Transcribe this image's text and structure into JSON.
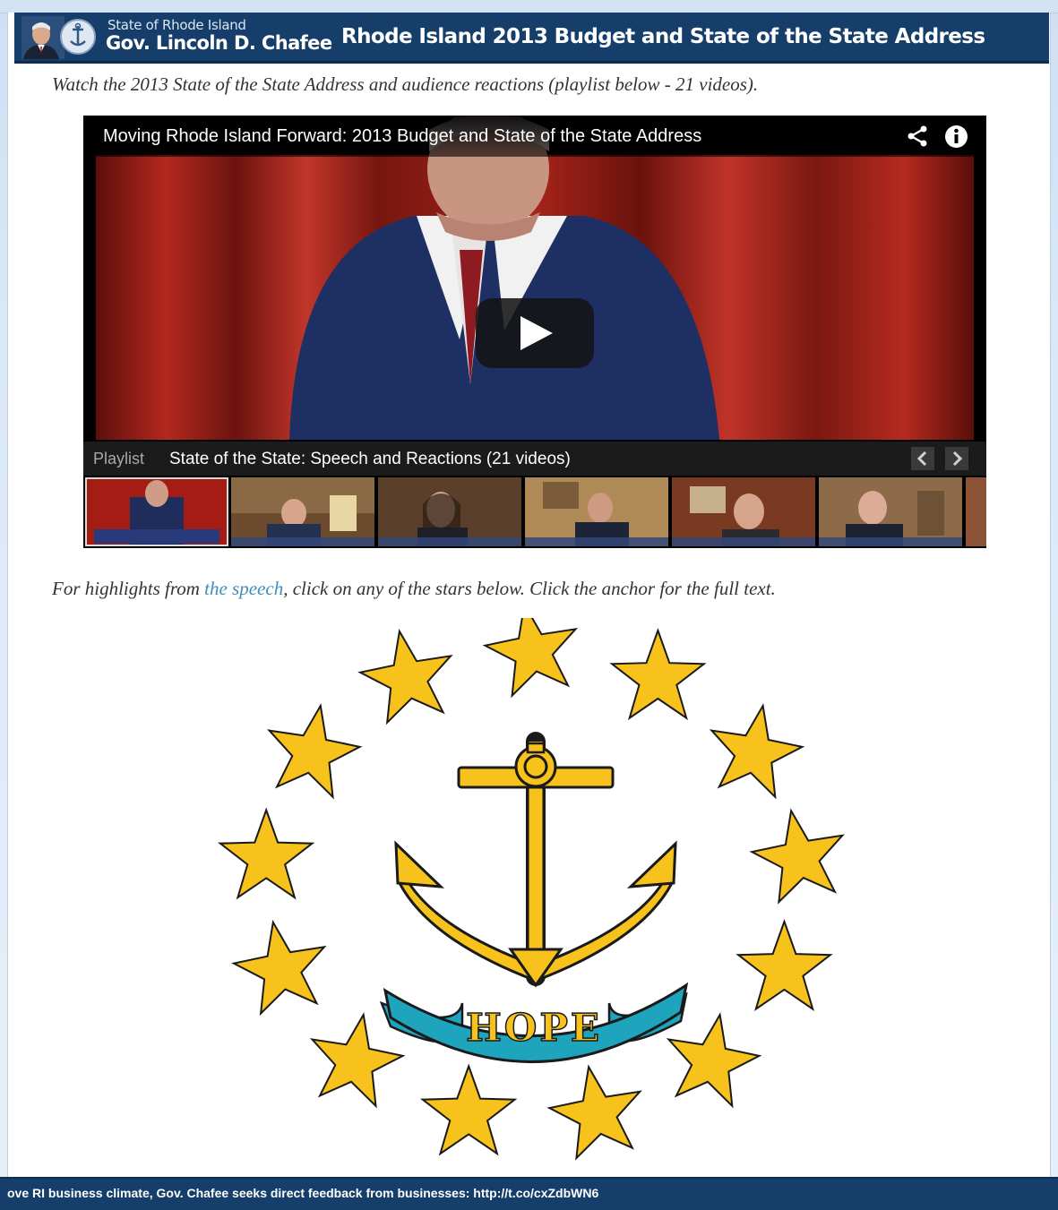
{
  "header": {
    "state_label": "State of Rhode Island",
    "governor_name": "Gov. Lincoln D. Chafee",
    "title": "Rhode Island 2013 Budget and State of the State Address"
  },
  "intro_text": "Watch the 2013 State of the State Address and audience reactions (playlist below - 21 videos).",
  "player": {
    "video_title": "Moving Rhode Island Forward: 2013 Budget and State of the State Address",
    "playlist_label": "Playlist",
    "playlist_name": "State of the State: Speech and Reactions (21 videos)",
    "share_icon": "share-icon",
    "info_icon": "info-icon",
    "play_icon": "play-icon",
    "prev_icon": "chevron-left-icon",
    "next_icon": "chevron-right-icon",
    "thumbnail_count": 7
  },
  "highlights": {
    "before_link": "For highlights from ",
    "link_text": "the speech",
    "after_link": ", click on any of the stars below. Click the anchor for the full text."
  },
  "seal": {
    "motto": "HOPE",
    "star_count": 13,
    "colors": {
      "gold": "#f6c21b",
      "ribbon": "#1fa4bd",
      "outline": "#1a1a1a"
    }
  },
  "ticker": {
    "text": "ove RI business climate, Gov. Chafee seeks direct feedback from businesses: http://t.co/cxZdbWN6"
  },
  "colors": {
    "header_bg": "#163e6a",
    "link": "#3a8fb7"
  }
}
